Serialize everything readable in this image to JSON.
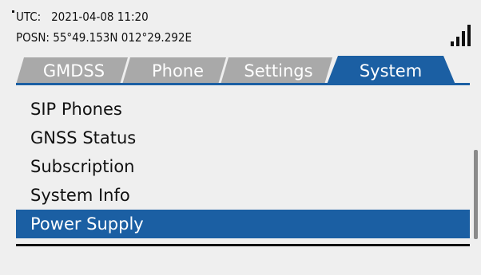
{
  "header": {
    "utc_label": "UTC:",
    "utc_value": "2021-04-08 11:20",
    "posn_label": "POSN:",
    "posn_value": "55°49.153N 012°29.292E"
  },
  "status": {
    "signal_icon": "signal-strength-icon",
    "signal_level": 4,
    "signal_max": 4
  },
  "tabs": [
    {
      "label": "GMDSS",
      "active": false
    },
    {
      "label": "Phone",
      "active": false
    },
    {
      "label": "Settings",
      "active": false
    },
    {
      "label": "System",
      "active": true
    }
  ],
  "menu": {
    "items": [
      {
        "label": "SIP Phones",
        "selected": false
      },
      {
        "label": "GNSS Status",
        "selected": false
      },
      {
        "label": "Subscription",
        "selected": false
      },
      {
        "label": "System Info",
        "selected": false
      },
      {
        "label": "Power Supply",
        "selected": true
      }
    ]
  },
  "colors": {
    "accent": "#1b5fa3",
    "inactive_tab": "#a9a9a9",
    "background": "#efefef"
  }
}
